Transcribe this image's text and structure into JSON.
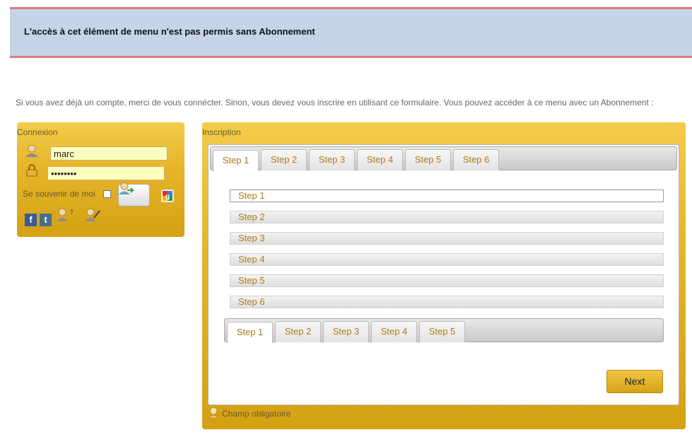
{
  "notice": {
    "text": "L'accès à cet élément de menu n'est pas permis sans Abonnement"
  },
  "intro": {
    "text": "Si vous avez déjà un compte, merci de vous connécter. Sinon, vous devez vous inscrire en utilisant ce formulaire. Vous pouvez accéder à ce menu avec un Abonnement :"
  },
  "login": {
    "title": "Connexion",
    "username_value": "marc",
    "password_value": "••••••••",
    "remember_label": "Se souvenir de moi",
    "social_labels": {
      "facebook": "f",
      "twitter": "t"
    }
  },
  "register": {
    "title": "Inscription",
    "top_tabs": [
      "Step 1",
      "Step 2",
      "Step 3",
      "Step 4",
      "Step 5",
      "Step 6"
    ],
    "accordion": [
      "Step 1",
      "Step 2",
      "Step 3",
      "Step 4",
      "Step 5",
      "Step 6"
    ],
    "bottom_tabs": [
      "Step 1",
      "Step 2",
      "Step 3",
      "Step 4",
      "Step 5"
    ],
    "next_label": "Next",
    "required_label": "Champ obligatoire"
  }
}
